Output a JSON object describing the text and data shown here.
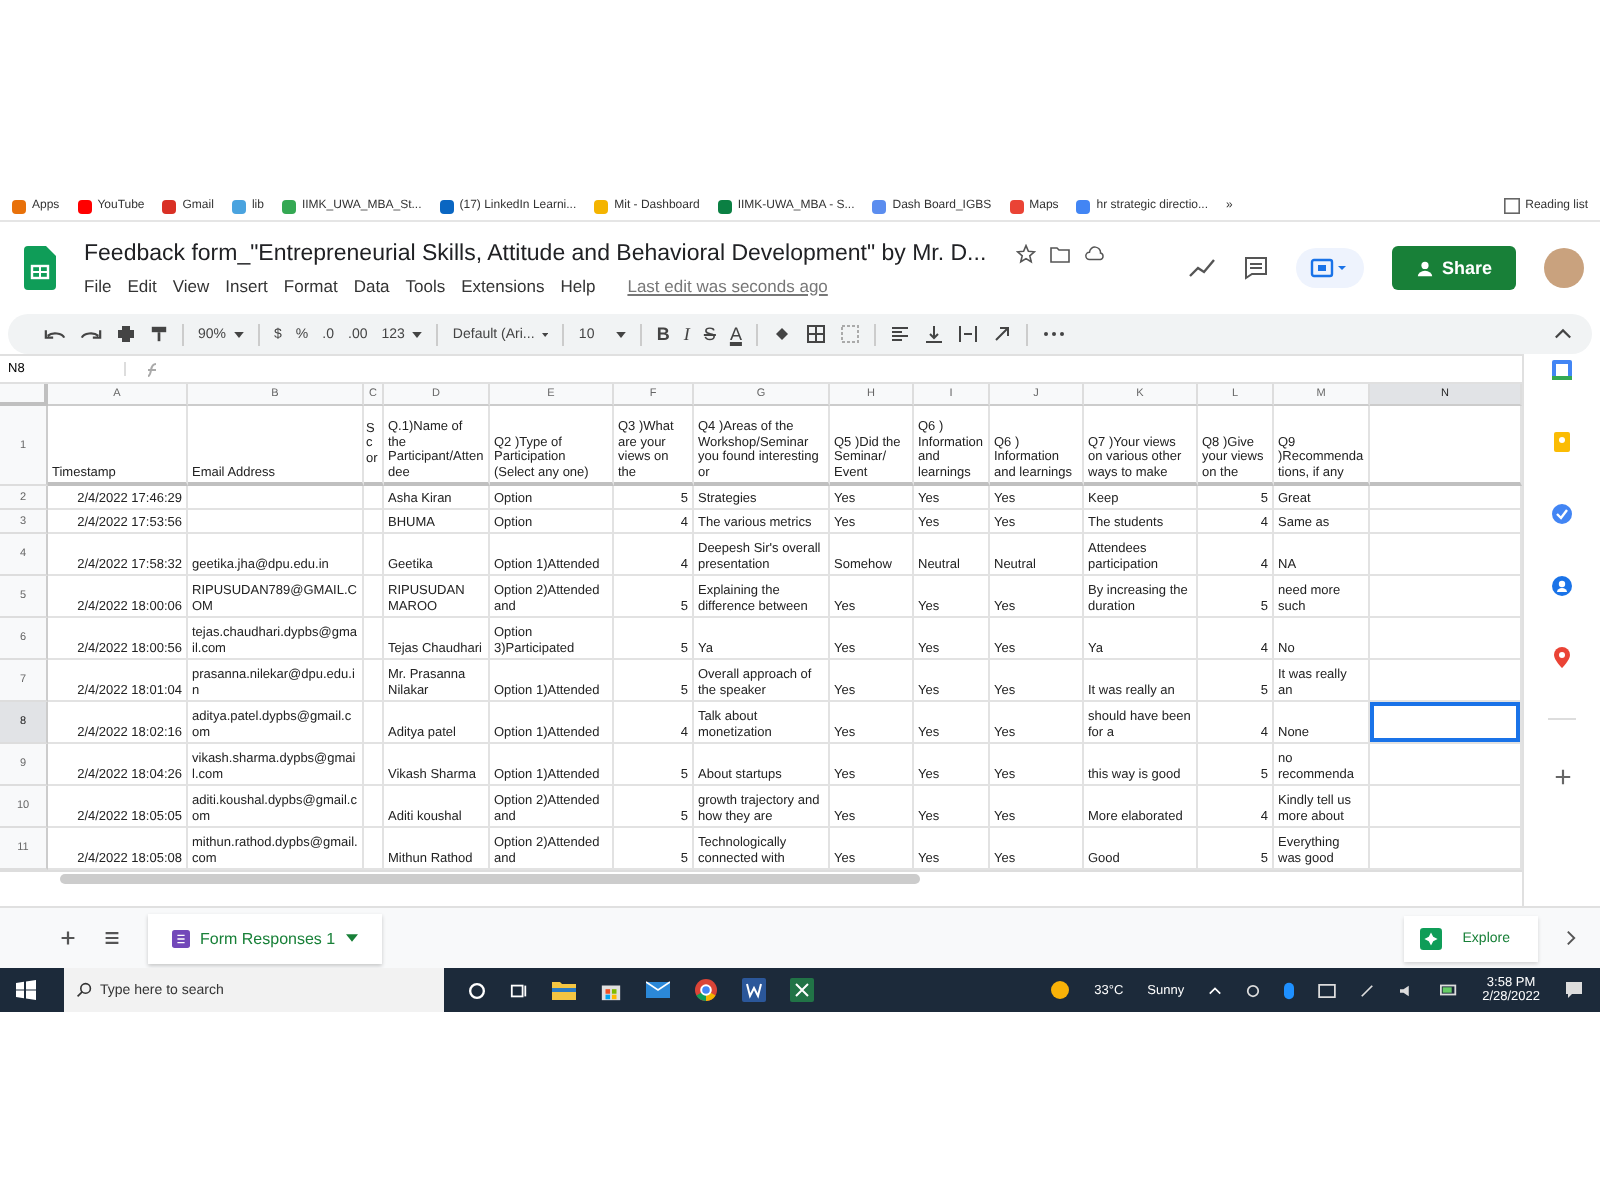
{
  "bookmarks": [
    {
      "label": "Apps",
      "color": "#e8710a"
    },
    {
      "label": "YouTube",
      "color": "#ff0000"
    },
    {
      "label": "Gmail",
      "color": "#d93025"
    },
    {
      "label": "lib",
      "color": "#4aa3df"
    },
    {
      "label": "IIMK_UWA_MBA_St...",
      "color": "#34a853"
    },
    {
      "label": "(17) LinkedIn Learni...",
      "color": "#0a66c2"
    },
    {
      "label": "Mit - Dashboard",
      "color": "#f4b400"
    },
    {
      "label": "IIMK-UWA_MBA - S...",
      "color": "#0b8043"
    },
    {
      "label": "Dash Board_IGBS",
      "color": "#5b8def"
    },
    {
      "label": "Maps",
      "color": "#ea4335"
    },
    {
      "label": "hr strategic directio...",
      "color": "#4285f4"
    }
  ],
  "bookmarks_more": "»",
  "reading_list": "Reading list",
  "doc": {
    "title": "Feedback form_\"Entrepreneurial Skills, Attitude and Behavioral Development\" by Mr. D...",
    "menu": [
      "File",
      "Edit",
      "View",
      "Insert",
      "Format",
      "Data",
      "Tools",
      "Extensions",
      "Help"
    ],
    "last_edit": "Last edit was seconds ago",
    "share": "Share"
  },
  "toolbar": {
    "zoom": "90%",
    "currency": "$",
    "percent": "%",
    "decimals_less": ".0",
    "decimals_more": ".00",
    "number_format": "123",
    "font": "Default (Ari...",
    "size": "10",
    "bold": "B",
    "italic": "I",
    "strike": "S",
    "text_color": "A"
  },
  "formula_bar": {
    "cell": "N8"
  },
  "sheet": {
    "columns": [
      {
        "letter": "A",
        "kind": "date",
        "selected": false
      },
      {
        "letter": "B",
        "kind": "text",
        "selected": false
      },
      {
        "letter": "C",
        "kind": "narrow",
        "selected": false
      },
      {
        "letter": "D",
        "kind": "text",
        "selected": false
      },
      {
        "letter": "E",
        "kind": "text",
        "selected": false
      },
      {
        "letter": "F",
        "kind": "number",
        "selected": false
      },
      {
        "letter": "G",
        "kind": "text",
        "selected": false
      },
      {
        "letter": "H",
        "kind": "text",
        "selected": false
      },
      {
        "letter": "I",
        "kind": "text",
        "selected": false
      },
      {
        "letter": "J",
        "kind": "text",
        "selected": false
      },
      {
        "letter": "K",
        "kind": "text",
        "selected": false
      },
      {
        "letter": "L",
        "kind": "number",
        "selected": false
      },
      {
        "letter": "M",
        "kind": "text",
        "selected": false
      },
      {
        "letter": "N",
        "kind": "text",
        "selected": true
      }
    ],
    "rows": [
      {
        "number": "1",
        "selected": false,
        "cells": [
          "Timestamp",
          "Email Address",
          "Scor",
          "Q.1)Name of the Participant/Attendee",
          "Q2 )Type of Participation (Select any one)",
          "Q3 )What are your views on the",
          "Q4 )Areas of the Workshop/Seminar you found interesting or",
          "Q5 )Did the Seminar/ Event",
          "Q6 ) Information and learnings",
          "Q6 ) Information and learnings",
          "Q7 )Your views on various other ways to make",
          "Q8 )Give your views on the",
          "Q9 )Recommendations, if any",
          null
        ]
      },
      {
        "number": "2",
        "selected": false,
        "cells": [
          "2/4/2022 17:46:29",
          null,
          null,
          "Asha Kiran",
          "Option",
          "5",
          "Strategies",
          "Yes",
          "Yes",
          "Yes",
          "Keep",
          "5",
          "Great",
          null
        ]
      },
      {
        "number": "3",
        "selected": false,
        "cells": [
          "2/4/2022 17:53:56",
          null,
          null,
          "BHUMA",
          "Option",
          "4",
          "The various metrics",
          "Yes",
          "Yes",
          "Yes",
          "The students",
          "4",
          "Same as",
          null
        ]
      },
      {
        "number": "4",
        "selected": false,
        "cells": [
          "2/4/2022 17:58:32",
          "geetika.jha@dpu.edu.in",
          null,
          "Geetika",
          "Option 1)Attended",
          "4",
          "Deepesh Sir's overall presentation",
          "Somehow",
          "Neutral",
          "Neutral",
          "Attendees participation",
          "4",
          "NA",
          null
        ]
      },
      {
        "number": "5",
        "selected": false,
        "cells": [
          "2/4/2022 18:00:06",
          "RIPUSUDAN789@GMAIL.COM",
          null,
          "RIPUSUDAN MAROO",
          "Option 2)Attended and",
          "5",
          "Explaining the difference between",
          "Yes",
          "Yes",
          "Yes",
          "By increasing the duration",
          "5",
          "need more such",
          null
        ]
      },
      {
        "number": "6",
        "selected": false,
        "cells": [
          "2/4/2022 18:00:56",
          "tejas.chaudhari.dypbs@gmail.com",
          null,
          "Tejas Chaudhari",
          "Option 3)Participated",
          "5",
          "Ya",
          "Yes",
          "Yes",
          "Yes",
          "Ya",
          "4",
          "No",
          null
        ]
      },
      {
        "number": "7",
        "selected": false,
        "cells": [
          "2/4/2022 18:01:04",
          "prasanna.nilekar@dpu.edu.in",
          null,
          "Mr. Prasanna Nilakar",
          "Option 1)Attended",
          "5",
          "Overall approach of the speaker",
          "Yes",
          "Yes",
          "Yes",
          "It was really an",
          "5",
          "It was really an",
          null
        ]
      },
      {
        "number": "8",
        "selected": true,
        "cells": [
          "2/4/2022 18:02:16",
          "aditya.patel.dypbs@gmail.com",
          null,
          "Aditya patel",
          "Option 1)Attended",
          "4",
          "Talk about monetization",
          "Yes",
          "Yes",
          "Yes",
          "should have been for a",
          "4",
          "None",
          null
        ]
      },
      {
        "number": "9",
        "selected": false,
        "cells": [
          "2/4/2022 18:04:26",
          "vikash.sharma.dypbs@gmail.com",
          null,
          "Vikash Sharma",
          "Option 1)Attended",
          "5",
          "About startups",
          "Yes",
          "Yes",
          "Yes",
          "this way is good",
          "5",
          "no recommenda",
          null
        ]
      },
      {
        "number": "10",
        "selected": false,
        "cells": [
          "2/4/2022 18:05:05",
          "aditi.koushal.dypbs@gmail.com",
          null,
          "Aditi koushal",
          "Option 2)Attended and",
          "5",
          "growth trajectory and how they are",
          "Yes",
          "Yes",
          "Yes",
          "More elaborated",
          "4",
          "Kindly tell us more about",
          null
        ]
      },
      {
        "number": "11",
        "selected": false,
        "cells": [
          "2/4/2022 18:05:08",
          "mithun.rathod.dypbs@gmail.com",
          null,
          "Mithun Rathod",
          "Option 2)Attended and",
          "5",
          "Technologically connected with",
          "Yes",
          "Yes",
          "Yes",
          "Good",
          "5",
          "Everything was good",
          null
        ]
      }
    ]
  },
  "sheet_tabs": [
    {
      "label": "Form Responses 1",
      "selected": true
    }
  ],
  "explore": "Explore",
  "taskbar": {
    "search": {
      "placeholder": "Type here to search"
    },
    "temperature": "33°C",
    "weather": "Sunny",
    "time": "3:58 PM",
    "date": "2/28/2022"
  }
}
